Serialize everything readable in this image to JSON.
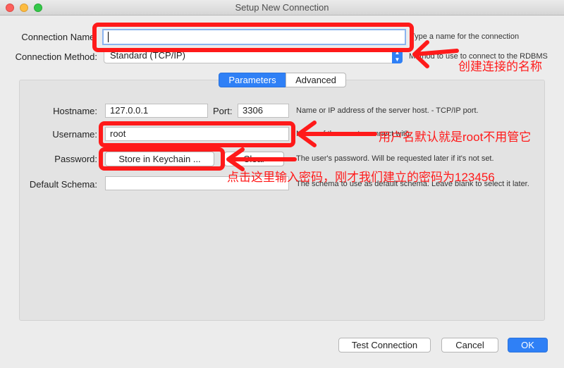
{
  "window": {
    "title": "Setup New Connection"
  },
  "connection_name": {
    "label": "Connection Name:",
    "value": "",
    "hint": "Type a name for the connection"
  },
  "connection_method": {
    "label": "Connection Method:",
    "value": "Standard (TCP/IP)",
    "hint": "Method to use to connect to the RDBMS"
  },
  "tabs": [
    {
      "label": "Parameters",
      "active": true
    },
    {
      "label": "Advanced",
      "active": false
    }
  ],
  "params": {
    "hostname": {
      "label": "Hostname:",
      "value": "127.0.0.1"
    },
    "port": {
      "label": "Port:",
      "value": "3306"
    },
    "host_hint": "Name or IP address of the server host. - TCP/IP port.",
    "username": {
      "label": "Username:",
      "value": "root",
      "hint": "Name of the user to connect with."
    },
    "password": {
      "label": "Password:",
      "store_label": "Store in Keychain ...",
      "clear_label": "Clear",
      "hint": "The user's password. Will be requested later if it's not set."
    },
    "schema": {
      "label": "Default Schema:",
      "value": "",
      "hint": "The schema to use as default schema. Leave blank to select it later."
    }
  },
  "buttons": {
    "test": "Test Connection",
    "cancel": "Cancel",
    "ok": "OK"
  },
  "annotations": {
    "name_note": "创建连接的名称",
    "user_note": "用户名默认就是root不用管它",
    "password_note": "点击这里输入密码，刚才我们建立的密码为123456",
    "color": "#ff1a1a"
  },
  "colors": {
    "accent": "#2f80f6"
  }
}
